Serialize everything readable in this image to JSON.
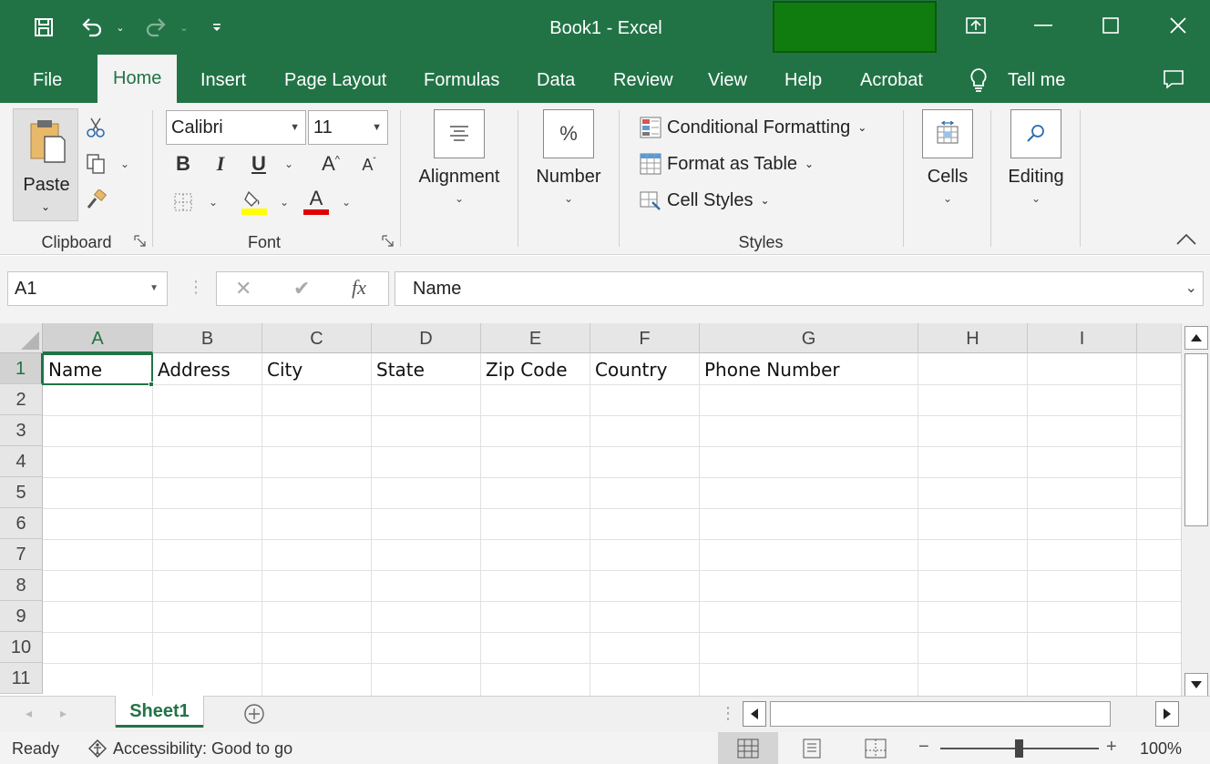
{
  "window": {
    "title": "Book1  -  Excel",
    "accent_color": "#217346",
    "highlight_block_color": "#107c10"
  },
  "quick_access": {
    "icons": [
      "save-icon",
      "undo-icon",
      "redo-icon",
      "customize-icon"
    ]
  },
  "tabs": [
    {
      "label": "File"
    },
    {
      "label": "Home",
      "active": true
    },
    {
      "label": "Insert"
    },
    {
      "label": "Page Layout"
    },
    {
      "label": "Formulas"
    },
    {
      "label": "Data"
    },
    {
      "label": "Review"
    },
    {
      "label": "View"
    },
    {
      "label": "Help"
    },
    {
      "label": "Acrobat"
    }
  ],
  "tell_me": "Tell me",
  "ribbon": {
    "clipboard": {
      "paste_label": "Paste",
      "group_label": "Clipboard"
    },
    "font": {
      "font_name": "Calibri",
      "font_size": "11",
      "bold": "B",
      "italic": "I",
      "underline": "U",
      "grow": "A",
      "shrink": "A",
      "font_color_letter": "A",
      "highlight_color": "#ffff00",
      "font_color": "#e00000",
      "group_label": "Font"
    },
    "alignment": {
      "label": "Alignment"
    },
    "number": {
      "label": "Number",
      "symbol": "%"
    },
    "styles": {
      "conditional_formatting": "Conditional Formatting",
      "format_as_table": "Format as Table",
      "cell_styles": "Cell Styles",
      "group_label": "Styles"
    },
    "cells": {
      "label": "Cells"
    },
    "editing": {
      "label": "Editing"
    }
  },
  "formula_bar": {
    "name_box": "A1",
    "fx": "fx",
    "content": "Name"
  },
  "grid": {
    "columns": [
      "A",
      "B",
      "C",
      "D",
      "E",
      "F",
      "G",
      "H",
      "I"
    ],
    "rows": [
      "1",
      "2",
      "3",
      "4",
      "5",
      "6",
      "7",
      "8",
      "9",
      "10",
      "11"
    ],
    "row1": [
      "Name",
      "Address",
      "City",
      "State",
      "Zip Code",
      "Country",
      "Phone Number"
    ],
    "active_cell": "A1"
  },
  "sheets": [
    {
      "name": "Sheet1",
      "active": true
    }
  ],
  "status": {
    "ready": "Ready",
    "accessibility": "Accessibility: Good to go",
    "zoom": "100%",
    "zoom_minus": "−",
    "zoom_plus": "+"
  }
}
